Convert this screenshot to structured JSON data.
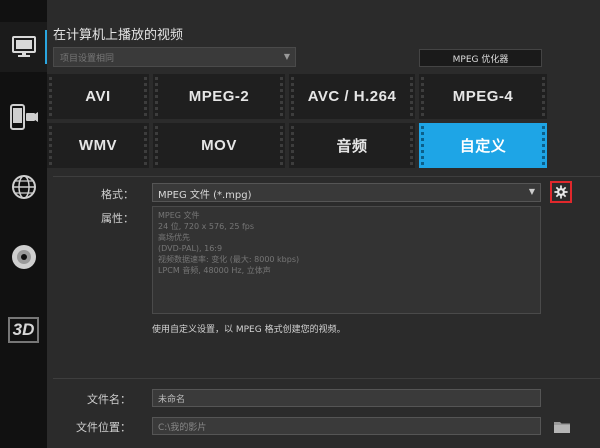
{
  "header": {
    "title": "在计算机上播放的视频",
    "profile_placeholder": "项目设置相同",
    "mpeg_optimizer_label": "MPEG 优化器"
  },
  "sidebar": {
    "items": [
      {
        "icon": "monitor-icon",
        "active": true
      },
      {
        "icon": "mobile-device-icon",
        "active": false
      },
      {
        "icon": "globe-icon",
        "active": false
      },
      {
        "icon": "disc-icon",
        "active": false
      },
      {
        "icon": "3d-icon",
        "label": "3D",
        "active": false
      }
    ]
  },
  "formats": [
    {
      "label": "AVI",
      "selected": false
    },
    {
      "label": "MPEG-2",
      "selected": false
    },
    {
      "label": "AVC / H.264",
      "selected": false
    },
    {
      "label": "MPEG-4",
      "selected": false
    },
    {
      "label": "WMV",
      "selected": false
    },
    {
      "label": "MOV",
      "selected": false
    },
    {
      "label": "音频",
      "selected": false
    },
    {
      "label": "自定义",
      "selected": true
    }
  ],
  "settings": {
    "format_label": "格式：",
    "format_value": "MPEG 文件 (*.mpg)",
    "properties_label": "属性：",
    "properties": [
      "MPEG 文件",
      "24 位, 720 x 576, 25 fps",
      "高场优先",
      "(DVD-PAL), 16:9",
      "视频数据速率: 变化 (最大: 8000 kbps)",
      "LPCM 音频, 48000 Hz, 立体声"
    ],
    "hint": "使用自定义设置，以 MPEG 格式创建您的视频。"
  },
  "output": {
    "filename_label": "文件名：",
    "filename_value": "未命名",
    "location_label": "文件位置：",
    "location_value": "C:\\我的影片"
  },
  "colors": {
    "accent": "#1ea5e6",
    "highlight_border": "#e0282c"
  }
}
